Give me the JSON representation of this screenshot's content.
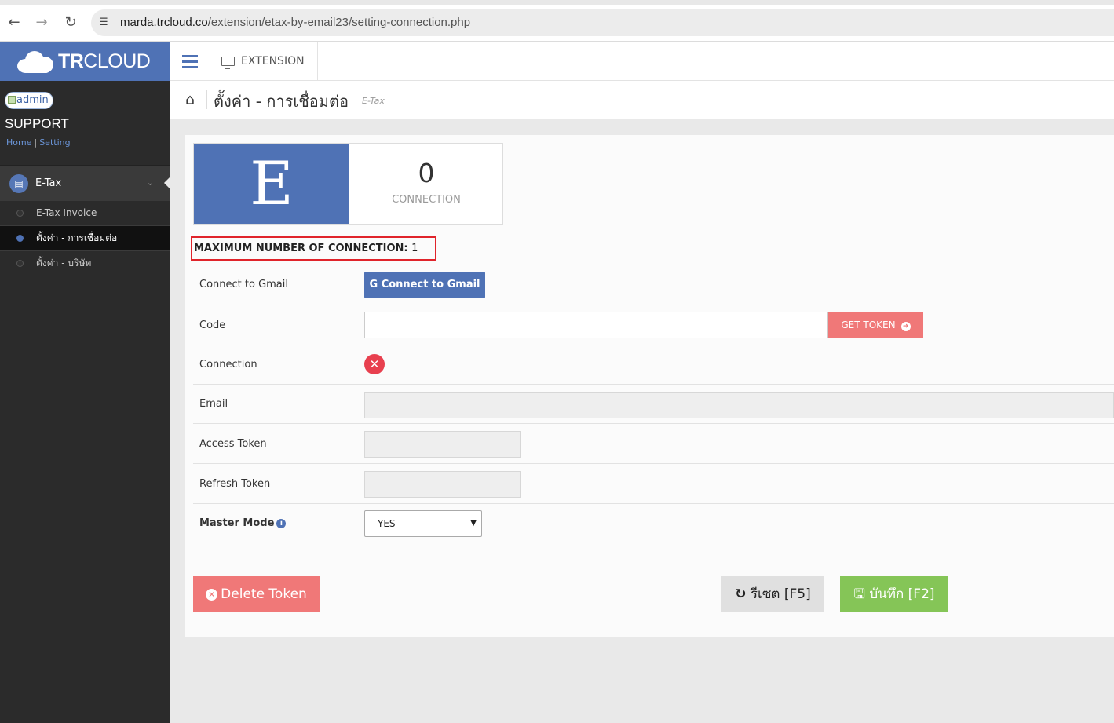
{
  "browser": {
    "url_host": "marda.trcloud.co",
    "url_path": "/extension/etax-by-email23/setting-connection.php"
  },
  "sidebar": {
    "logo_bold": "TR",
    "logo_rest": "CLOUD",
    "avatar_alt": "admin",
    "user_name": "SUPPORT",
    "links": [
      "Home",
      "Setting"
    ],
    "group_label": "E-Tax",
    "items": [
      {
        "label": "E-Tax Invoice"
      },
      {
        "label": "ตั้งค่า - การเชื่อมต่อ"
      },
      {
        "label": "ตั้งค่า - บริษัท"
      }
    ]
  },
  "topbar": {
    "tab_label": "EXTENSION"
  },
  "page": {
    "title": "ตั้งค่า - การเชื่อมต่อ",
    "subtitle": "E-Tax"
  },
  "stat": {
    "letter": "E",
    "value": "0",
    "caption": "CONNECTION"
  },
  "max_connection": {
    "label": "MAXIMUM NUMBER OF CONNECTION:",
    "value": "1"
  },
  "form": {
    "gmail_label": "Connect to Gmail",
    "gmail_button": "Connect to Gmail",
    "gmail_button_icon": "G",
    "code_label": "Code",
    "code_value": "",
    "get_token_button": "GET TOKEN",
    "connection_label": "Connection",
    "email_label": "Email",
    "email_value": "",
    "access_token_label": "Access Token",
    "access_token_value": "",
    "refresh_token_label": "Refresh Token",
    "refresh_token_value": "",
    "master_mode_label": "Master Mode",
    "master_mode_value": "YES"
  },
  "actions": {
    "delete_token": "Delete Token",
    "reset": "รีเซต [F5]",
    "save": "บันทึก [F2]"
  },
  "colors": {
    "brand_blue": "#4f72b5",
    "danger": "#f07878",
    "success": "#85c557",
    "highlight_border": "#e0242b"
  }
}
